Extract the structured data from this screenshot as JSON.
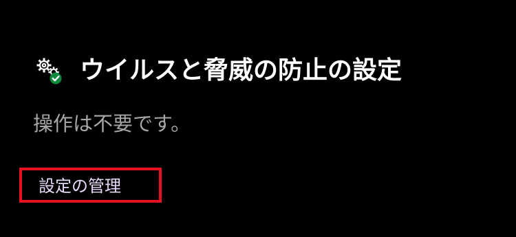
{
  "section": {
    "icon": "gear-checkmark-icon",
    "title": "ウイルスと脅威の防止の設定",
    "status": "操作は不要です。",
    "manage_link_label": "設定の管理"
  },
  "colors": {
    "background": "#000000",
    "title": "#ffffff",
    "status": "#a6a6a6",
    "link": "#e8d9fa",
    "highlight_border": "#e81123",
    "check_badge": "#10893e"
  }
}
